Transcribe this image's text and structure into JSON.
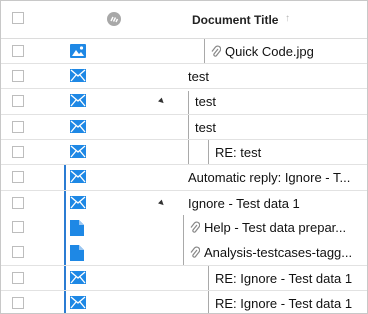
{
  "grid": {
    "header": {
      "title": "Document Title",
      "sync_icon": "sync-icon",
      "sort_icon": "sort-arrow-up-icon"
    },
    "rows": [
      {
        "icon": "image-icon",
        "title": "Quick Code.jpg",
        "attachment": true
      },
      {
        "icon": "mail-icon",
        "title": "test"
      },
      {
        "icon": "mail-icon",
        "title": "test",
        "expanded": true
      },
      {
        "icon": "mail-icon",
        "title": "test"
      },
      {
        "icon": "mail-icon",
        "title": "RE: test"
      },
      {
        "icon": "mail-icon",
        "title": "Automatic reply: Ignore - T..."
      },
      {
        "icon": "mail-icon",
        "title": "Ignore - Test data 1",
        "expanded": true
      },
      {
        "icon": "document-icon",
        "title": "Help - Test data prepar...",
        "attachment": true
      },
      {
        "icon": "document-icon",
        "title": "Analysis-testcases-tagg...",
        "attachment": true
      },
      {
        "icon": "mail-icon",
        "title": "RE: Ignore - Test data 1"
      },
      {
        "icon": "mail-icon",
        "title": "RE: Ignore - Test data 1"
      }
    ]
  },
  "colors": {
    "accent": "#2b7cd3",
    "icon": "#1e88e5"
  }
}
